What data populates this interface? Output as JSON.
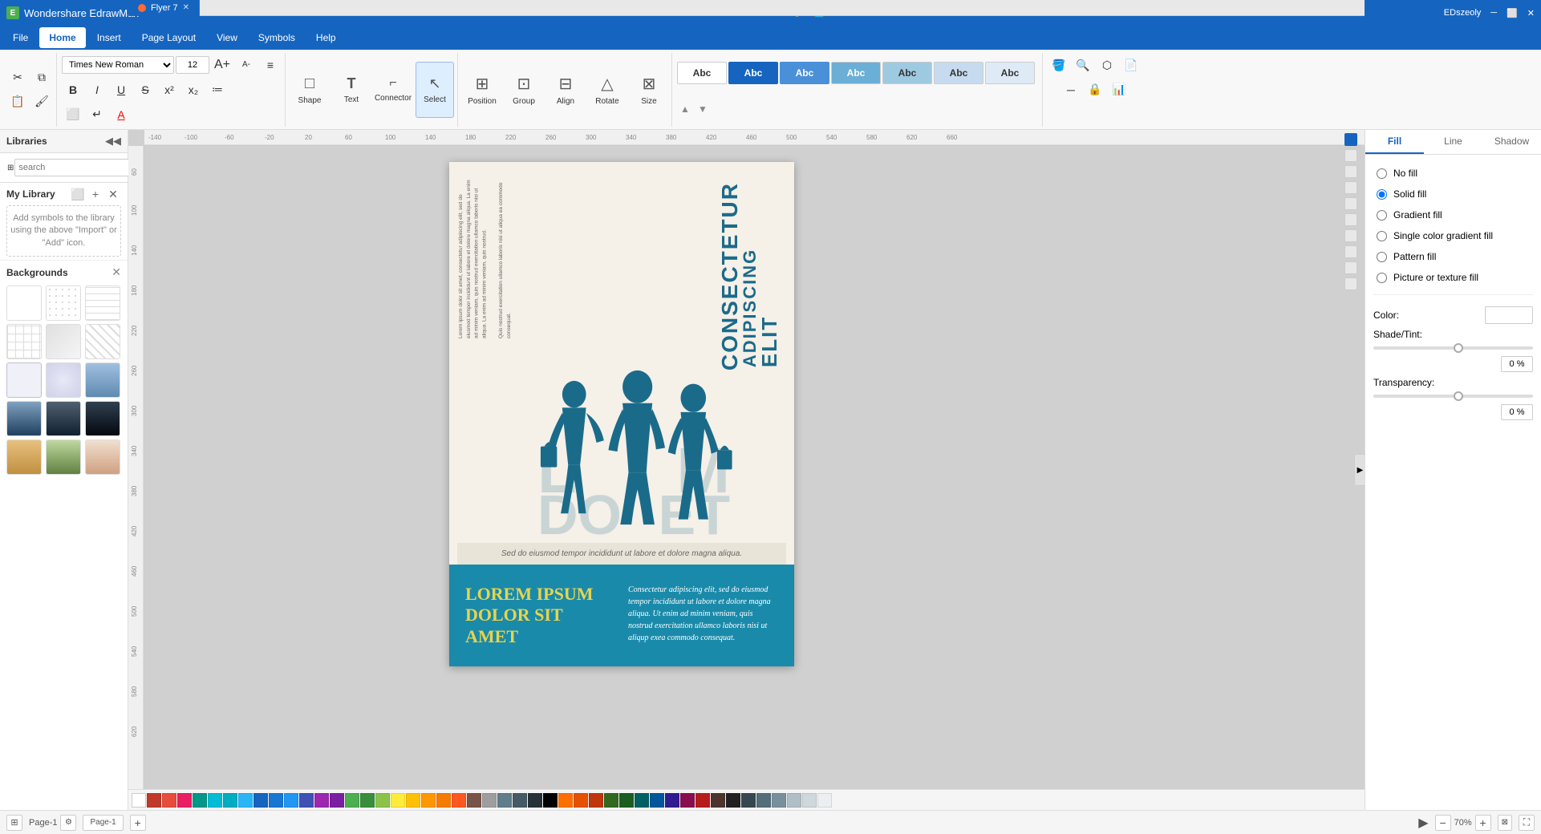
{
  "app": {
    "title": "Wondershare EdrawMax",
    "file_name": "Flyer 7"
  },
  "title_bar": {
    "app_name": "Wondershare EdrawMax",
    "user": "EDszeoly",
    "window_controls": [
      "minimize",
      "restore",
      "close"
    ]
  },
  "menu": {
    "items": [
      "File",
      "Home",
      "Insert",
      "Page Layout",
      "View",
      "Symbols",
      "Help"
    ],
    "active": "Home"
  },
  "toolbar": {
    "font_name": "Times New Roman",
    "font_size": "12",
    "tools": [
      {
        "id": "shape",
        "label": "Shape",
        "icon": "□"
      },
      {
        "id": "text",
        "label": "Text",
        "icon": "T"
      },
      {
        "id": "connector",
        "label": "Connector",
        "icon": "⌐"
      },
      {
        "id": "select",
        "label": "Select",
        "icon": "↖"
      }
    ],
    "position_label": "Position",
    "group_label": "Group",
    "align_label": "Align",
    "rotate_label": "Rotate",
    "size_label": "Size"
  },
  "right_panel": {
    "tabs": [
      "Fill",
      "Line",
      "Shadow"
    ],
    "active_tab": "Fill",
    "fill_options": [
      {
        "id": "no-fill",
        "label": "No fill"
      },
      {
        "id": "solid-fill",
        "label": "Solid fill"
      },
      {
        "id": "gradient-fill",
        "label": "Gradient fill"
      },
      {
        "id": "single-color-gradient",
        "label": "Single color gradient fill"
      },
      {
        "id": "pattern-fill",
        "label": "Pattern fill"
      },
      {
        "id": "picture-texture",
        "label": "Picture or texture fill"
      }
    ],
    "color_label": "Color:",
    "shade_tint_label": "Shade/Tint:",
    "transparency_label": "Transparency:",
    "shade_value": "0 %",
    "transparency_value": "0 %"
  },
  "left_sidebar": {
    "title": "Libraries",
    "search_placeholder": "search",
    "my_library": {
      "title": "My Library",
      "empty_text": "Add symbols to the library using the above \"Import\" or \"Add\" icon."
    },
    "backgrounds": {
      "title": "Backgrounds"
    }
  },
  "canvas": {
    "tab_label": "Flyer 7",
    "zoom": "70%"
  },
  "flyer": {
    "vertical_texts": [
      "Lorem ipsum dolor sit amet, consectetur adipiscing elit, sed do eiusmod tempor incididunt ut labore et dolore magna aliqua. La enim ad minim veniam, quis nostrud exercitation ullamco laboris nisi ut aliqua. La enim ad minim veniam, quis nostrud.",
      "Quis nostrud exercitation ullamco laboris nisi ut aliqua ea commodo consequat."
    ],
    "title_main": "CONSECTETUR\nADIPISCING\nELIT",
    "bg_letters": [
      "L",
      "M",
      "DO",
      "ET"
    ],
    "caption": "Sed do eiusmod tempor incididunt ut labore et dolore magna aliqua.",
    "bottom_title": "LOREM IPSUM\nDOLOR SIT\nAMET",
    "bottom_text": "Consectetur adipiscing elit, sed do eiusmod tempor incididunt ut labore et dolore magna aliqua. Ut enim ad minim veniam, quis nostrud exercitation ullamco laboris nisi ut aliqup exea commodo consequat."
  },
  "status_bar": {
    "page_label": "Page-1",
    "pages": [
      "Page-1"
    ],
    "zoom": "70%",
    "add_page": "+"
  },
  "colors": {
    "primary_blue": "#1565c0",
    "accent_teal": "#1a8aaa",
    "flyer_bg": "#f5f0e8",
    "flyer_text": "#1a6b8a",
    "flyer_yellow": "#e8d44d"
  }
}
